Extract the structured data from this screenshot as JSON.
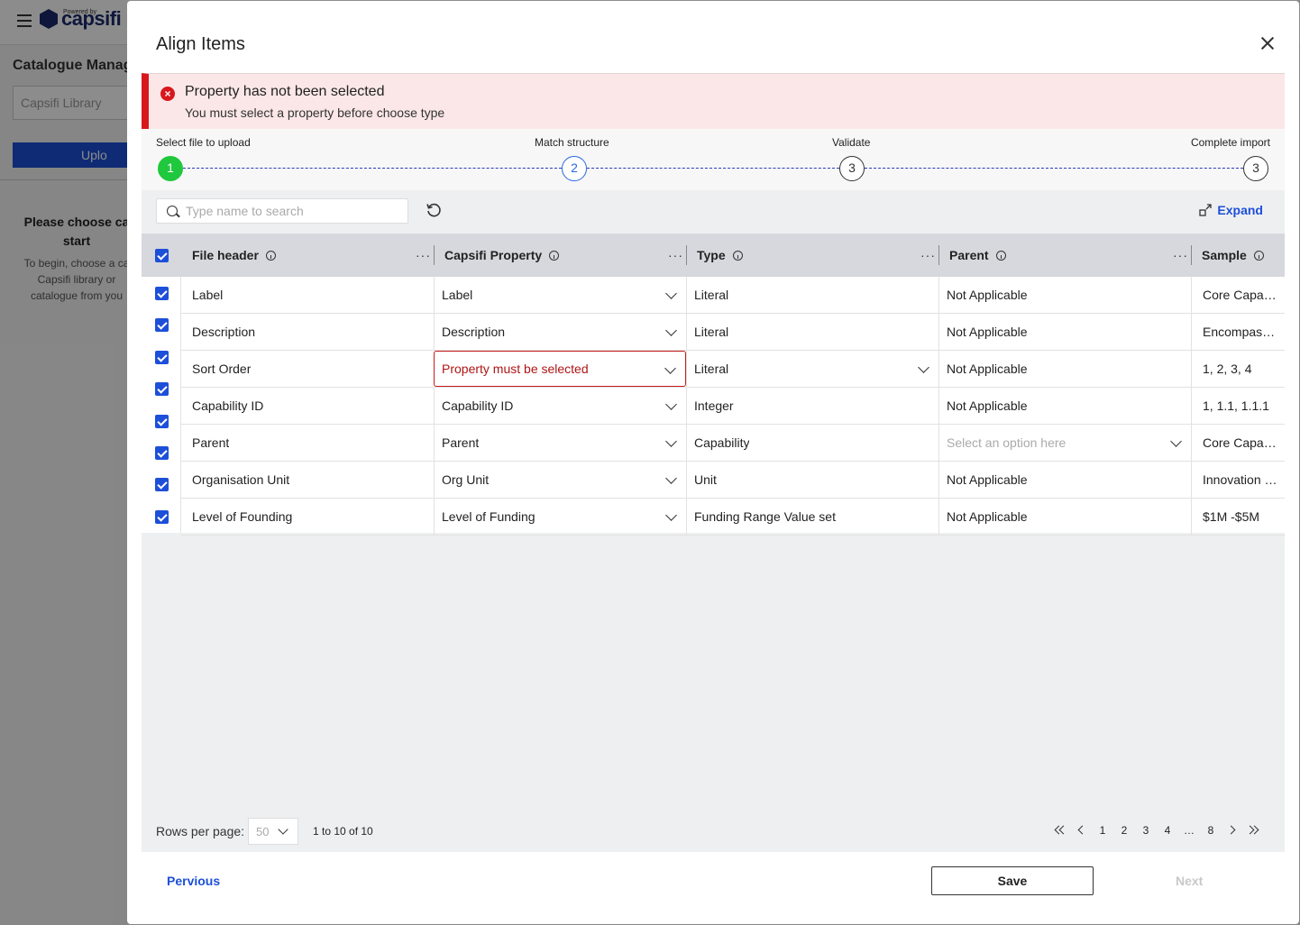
{
  "background": {
    "logo_powered": "Powered by",
    "logo_text": "capsifi",
    "page_title": "Catalogue Manag",
    "library_input": "Capsifi Library",
    "upload_label": "Uplo",
    "choose_title": "Please choose ca start",
    "choose_desc": "To begin, choose a ca Capsifi library or catalogue from you"
  },
  "modal": {
    "title": "Align Items",
    "alert": {
      "title": "Property has not been selected",
      "message": "You must select a property before choose type"
    },
    "steps": [
      {
        "label": "Select file to upload",
        "number": "1",
        "state": "done"
      },
      {
        "label": "Match structure",
        "number": "2",
        "state": "active"
      },
      {
        "label": "Validate",
        "number": "3",
        "state": "pending"
      },
      {
        "label": "Complete import",
        "number": "3",
        "state": "pending"
      }
    ],
    "search_placeholder": "Type name to search",
    "expand_label": "Expand",
    "columns": [
      "File header",
      "Capsifi Property",
      "Type",
      "Parent",
      "Sample"
    ],
    "rows": [
      {
        "file_header": "Label",
        "property": "Label",
        "type": "Literal",
        "parent": "Not Applicable",
        "sample": "Core Capabilities"
      },
      {
        "file_header": "Description",
        "property": "Description",
        "type": "Literal",
        "parent": "Not Applicable",
        "sample": "Encompasses"
      },
      {
        "file_header": "Sort Order",
        "property": "Property must be selected",
        "type": "Literal",
        "parent": "Not Applicable",
        "sample": "1, 2, 3, 4"
      },
      {
        "file_header": "Capability ID",
        "property": "Capability ID",
        "type": "Integer",
        "parent": "Not Applicable",
        "sample": "1, 1.1, 1.1.1"
      },
      {
        "file_header": "Parent",
        "property": "Parent",
        "type": "Capability",
        "parent": "Select an option here",
        "sample": "Core Capabilities"
      },
      {
        "file_header": "Organisation Unit",
        "property": "Org Unit",
        "type": "Unit",
        "parent": "Not Applicable",
        "sample": "Innovation Hub"
      },
      {
        "file_header": "Level of Founding",
        "property": "Level of Funding",
        "type": "Funding Range Value set",
        "parent": "Not Applicable",
        "sample": "$1M -$5M"
      }
    ],
    "pager": {
      "rows_label": "Rows per page:",
      "rows_value": "50",
      "range": "1 to 10 of 10",
      "pages": [
        "1",
        "2",
        "3",
        "4",
        "…",
        "8"
      ]
    },
    "footer": {
      "previous": "Pervious",
      "save": "Save",
      "next": "Next"
    },
    "colors": {
      "accent": "#1d4fd8",
      "error": "#d8171d",
      "success": "#1fc83c"
    }
  }
}
